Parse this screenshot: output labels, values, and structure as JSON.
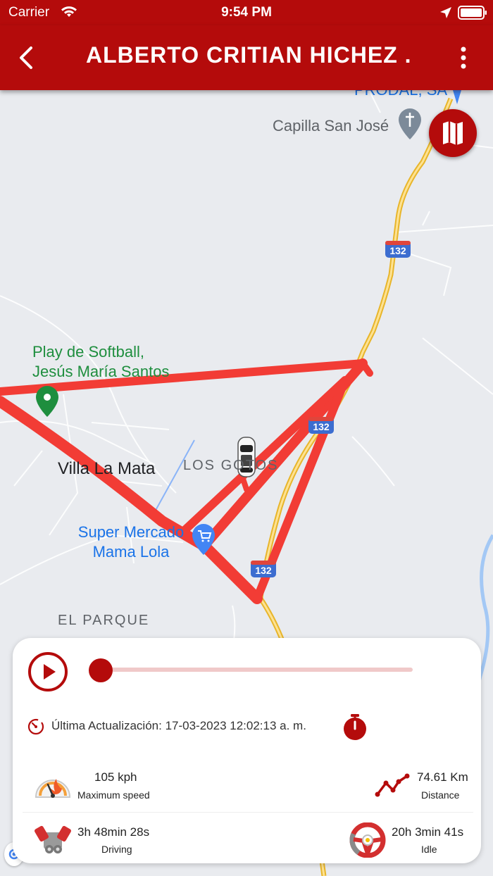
{
  "status_bar": {
    "carrier": "Carrier",
    "time": "9:54 PM"
  },
  "app_bar": {
    "title": "ALBERTO CRITIAN HICHEZ ...",
    "back_icon": "chevron-left-icon",
    "more_icon": "more-vertical-icon",
    "background_color": "#b40b0b"
  },
  "map": {
    "labels": {
      "prodal": "PRODAL, SA",
      "capilla": "Capilla San José",
      "softball_line1": "Play de Softball,",
      "softball_line2": "Jesús María Santos",
      "villa": "Villa La Mata",
      "los_gotos": "LOS GOTOS",
      "super_line1": "Super Mercado",
      "super_line2": "Mama Lola",
      "el_parque": "EL PARQUE"
    },
    "highway_shields": [
      "132",
      "132",
      "132"
    ],
    "route_color": "#f23c35",
    "layer_button_icon": "map-icon"
  },
  "playback": {
    "progress": 0,
    "last_update": "Última Actualización: 17-03-2023 12:02:13 a. m.",
    "accent_color": "#b40b0b"
  },
  "stats": {
    "max_speed": {
      "value": "105 kph",
      "label": "Maximum speed",
      "icon": "speedometer-icon"
    },
    "distance": {
      "value": "74.61 Km",
      "label": "Distance",
      "icon": "route-graph-icon"
    },
    "driving": {
      "value": "3h 48min 28s",
      "label": "Driving",
      "icon": "engine-icon"
    },
    "idle": {
      "value": "20h 3min 41s",
      "label": "Idle",
      "icon": "steering-wheel-icon"
    }
  }
}
